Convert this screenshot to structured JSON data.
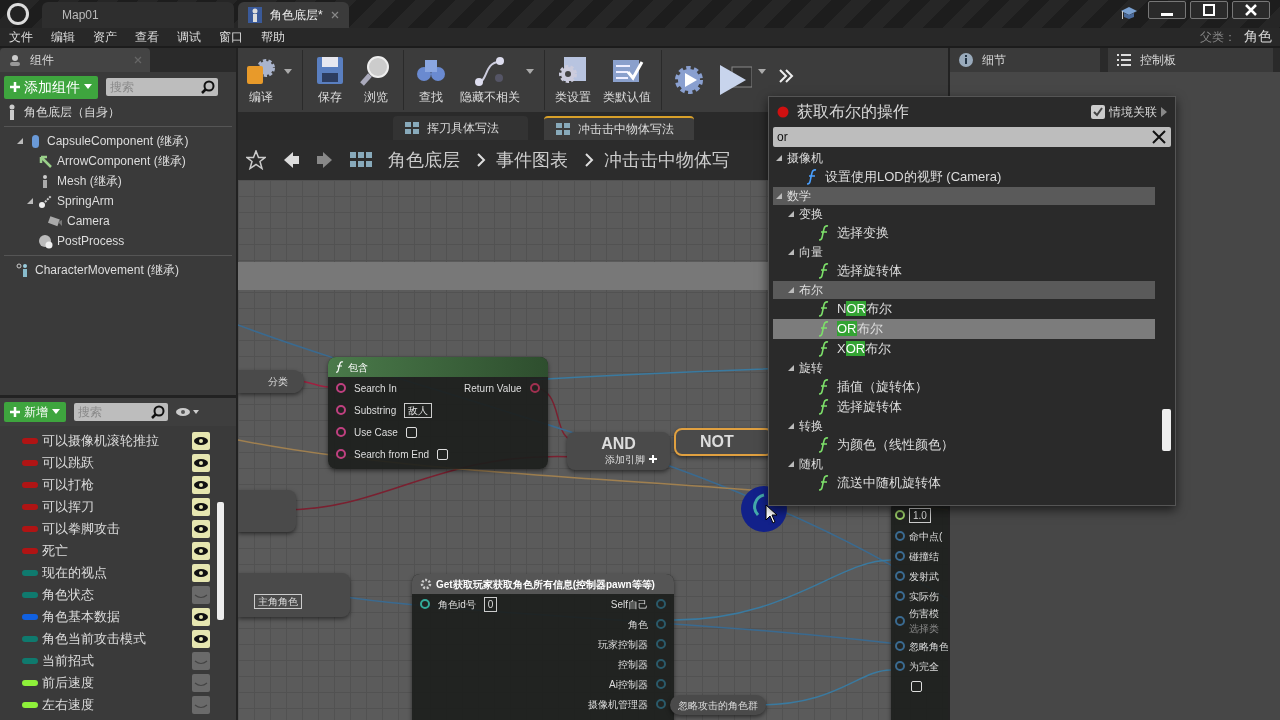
{
  "title_bar": {
    "tabs": [
      {
        "label": "Map01",
        "selected": false
      },
      {
        "label": "角色底层*",
        "selected": true
      }
    ]
  },
  "menu": [
    "文件",
    "编辑",
    "资产",
    "查看",
    "调试",
    "窗口",
    "帮助"
  ],
  "parent_class": {
    "label": "父类：",
    "value": "角色"
  },
  "components_panel": {
    "title": "组件",
    "add_button": "添加组件",
    "search": {
      "placeholder": "搜索"
    },
    "root": "角色底层（自身）",
    "tree": [
      {
        "label": "CapsuleComponent (继承)",
        "kind": "capsule",
        "expanded": true,
        "children": [
          {
            "label": "ArrowComponent (继承)",
            "kind": "arrow"
          },
          {
            "label": "Mesh (继承)",
            "kind": "mesh"
          },
          {
            "label": "SpringArm",
            "kind": "spring",
            "expanded": true,
            "children": [
              {
                "label": "Camera",
                "kind": "camera"
              }
            ]
          },
          {
            "label": "PostProcess",
            "kind": "sphere"
          }
        ]
      }
    ],
    "extra": [
      {
        "label": "CharacterMovement (继承)",
        "kind": "movement"
      }
    ]
  },
  "toolbar": [
    {
      "label": "编译",
      "kind": "compile",
      "dropdown": true
    },
    {
      "label": "保存",
      "kind": "save",
      "dropdown": false
    },
    {
      "label": "浏览",
      "kind": "browse",
      "dropdown": false
    },
    {
      "label": "查找",
      "kind": "find",
      "dropdown": false
    },
    {
      "label": "隐藏不相关",
      "kind": "hide",
      "dropdown": true
    },
    {
      "label": "类设置",
      "kind": "settings",
      "dropdown": false
    },
    {
      "label": "类默认值",
      "kind": "defaults",
      "dropdown": false
    },
    {
      "kind": "simulate",
      "dropdown": false
    },
    {
      "kind": "play",
      "dropdown": true
    }
  ],
  "graph_tabs": [
    {
      "label": "挥刀具体写法",
      "selected": false
    },
    {
      "label": "冲击击中物体写法",
      "selected": true
    }
  ],
  "breadcrumb": [
    "角色底层",
    "事件图表",
    "冲击击中物体写"
  ],
  "my_blueprint": {
    "new_button": "新增",
    "search": {
      "placeholder": "搜索"
    },
    "variables": [
      {
        "name": "可以摄像机滚轮推拉",
        "color": "#b01414",
        "visible": true
      },
      {
        "name": "可以跳跃",
        "color": "#b01414",
        "visible": true
      },
      {
        "name": "可以打枪",
        "color": "#b01414",
        "visible": true
      },
      {
        "name": "可以挥刀",
        "color": "#b01414",
        "visible": true
      },
      {
        "name": "可以拳脚攻击",
        "color": "#b01414",
        "visible": true
      },
      {
        "name": "死亡",
        "color": "#b01414",
        "visible": true
      },
      {
        "name": "现在的视点",
        "color": "#0f7a6e",
        "visible": true
      },
      {
        "name": "角色状态",
        "color": "#0f7a6e",
        "visible": false
      },
      {
        "name": "角色基本数据",
        "color": "#1060e0",
        "visible": true
      },
      {
        "name": "角色当前攻击模式",
        "color": "#0f7a6e",
        "visible": true
      },
      {
        "name": "当前招式",
        "color": "#0f7a6e",
        "visible": false
      },
      {
        "name": "前后速度",
        "color": "#8ef03a",
        "visible": false
      },
      {
        "name": "左右速度",
        "color": "#8ef03a",
        "visible": false
      }
    ]
  },
  "details_panel": {
    "tabs": [
      {
        "label": "细节",
        "kind": "info"
      },
      {
        "label": "控制板",
        "kind": "list"
      }
    ]
  },
  "graph": {
    "nodes": [
      {
        "kind": "pill",
        "label": "分类"
      },
      {
        "kind": "function",
        "title": "包含",
        "inputs": [
          {
            "label": "Search In",
            "kind": "pin"
          },
          {
            "label": "Substring",
            "kind": "text",
            "value": "敌人"
          },
          {
            "label": "Use Case",
            "kind": "check",
            "checked": false
          },
          {
            "label": "Search from End",
            "kind": "check",
            "checked": false
          }
        ],
        "outputs": [
          {
            "label": "Return Value"
          }
        ]
      },
      {
        "kind": "and",
        "label": "AND",
        "add_pin": "添加引脚"
      },
      {
        "kind": "not",
        "label": "NOT",
        "selected": true
      },
      {
        "kind": "stub"
      },
      {
        "kind": "literal",
        "value": "主角角色"
      },
      {
        "kind": "macro",
        "title": "Get获取玩家获取角色所有信息(控制器pawn等等)",
        "inputs": [
          {
            "label": "角色id号",
            "kind": "text",
            "value": "0"
          }
        ],
        "outputs": [
          {
            "label": "Self自己"
          },
          {
            "label": "角色"
          },
          {
            "label": "玩家控制器"
          },
          {
            "label": "控制器"
          },
          {
            "label": "Ai控制器"
          },
          {
            "label": "摄像机管理器"
          }
        ]
      },
      {
        "kind": "variable",
        "label": "忽略攻击的角色群"
      },
      {
        "kind": "partial",
        "rows": [
          {
            "kind": "text",
            "value": "1.0"
          },
          {
            "kind": "pin",
            "label": "命中点("
          },
          {
            "kind": "pin",
            "label": "碰撞结"
          },
          {
            "kind": "pin",
            "label": "发射武"
          },
          {
            "kind": "pin",
            "label": "实际伤"
          },
          {
            "kind": "pin",
            "label": "伤害模",
            "sub": "选择类"
          },
          {
            "kind": "pin",
            "label": "忽略角色"
          },
          {
            "kind": "pin",
            "label": "为完全"
          },
          {
            "kind": "check",
            "checked": false
          }
        ]
      }
    ]
  },
  "action_menu": {
    "title": "获取布尔的操作",
    "context_sensitive": {
      "label": "情境关联",
      "checked": true
    },
    "search": {
      "value": "or"
    },
    "tree": [
      {
        "kind": "category",
        "label": "摄像机",
        "highlighted": false,
        "expanded": true,
        "children": [
          {
            "kind": "function",
            "label_parts": [
              {
                "text": "设置使用LOD的视野 (Camera)",
                "match": false
              }
            ],
            "color": "#4aa0ff",
            "selected": false
          }
        ]
      },
      {
        "kind": "category",
        "label": "数学",
        "highlighted": true,
        "expanded": true,
        "children": [
          {
            "kind": "category",
            "label": "变换",
            "highlighted": false,
            "expanded": true,
            "children": [
              {
                "kind": "function",
                "label_parts": [
                  {
                    "text": "选择变换",
                    "match": false
                  }
                ],
                "color": "#7de06a",
                "selected": false
              }
            ]
          },
          {
            "kind": "category",
            "label": "向量",
            "highlighted": false,
            "expanded": true,
            "children": [
              {
                "kind": "function",
                "label_parts": [
                  {
                    "text": "选择旋转体",
                    "match": false
                  }
                ],
                "color": "#7de06a",
                "selected": false
              }
            ]
          },
          {
            "kind": "category",
            "label": "布尔",
            "highlighted": true,
            "expanded": true,
            "children": [
              {
                "kind": "function",
                "label_parts": [
                  {
                    "text": "N",
                    "match": false
                  },
                  {
                    "text": "OR",
                    "match": true
                  },
                  {
                    "text": "布尔",
                    "match": false
                  }
                ],
                "color": "#7de06a",
                "selected": false
              },
              {
                "kind": "function",
                "label_parts": [
                  {
                    "text": "OR",
                    "match": true
                  },
                  {
                    "text": "布尔",
                    "match": false
                  }
                ],
                "color": "#7de06a",
                "selected": true
              },
              {
                "kind": "function",
                "label_parts": [
                  {
                    "text": "X",
                    "match": false
                  },
                  {
                    "text": "OR",
                    "match": true
                  },
                  {
                    "text": "布尔",
                    "match": false
                  }
                ],
                "color": "#7de06a",
                "selected": false
              }
            ]
          },
          {
            "kind": "category",
            "label": "旋转",
            "highlighted": false,
            "expanded": true,
            "children": [
              {
                "kind": "function",
                "label_parts": [
                  {
                    "text": "插值（旋转体）",
                    "match": false
                  }
                ],
                "color": "#7de06a",
                "selected": false
              },
              {
                "kind": "function",
                "label_parts": [
                  {
                    "text": "选择旋转体",
                    "match": false
                  }
                ],
                "color": "#7de06a",
                "selected": false
              }
            ]
          },
          {
            "kind": "category",
            "label": "转换",
            "highlighted": false,
            "expanded": true,
            "children": [
              {
                "kind": "function",
                "label_parts": [
                  {
                    "text": "为颜色（线性颜色）",
                    "match": false
                  }
                ],
                "color": "#7de06a",
                "selected": false
              }
            ]
          },
          {
            "kind": "category",
            "label": "随机",
            "highlighted": false,
            "expanded": true,
            "children": [
              {
                "kind": "function",
                "label_parts": [
                  {
                    "text": "流送中随机旋转体",
                    "match": false
                  }
                ],
                "color": "#7de06a",
                "selected": false
              }
            ]
          }
        ]
      }
    ]
  }
}
